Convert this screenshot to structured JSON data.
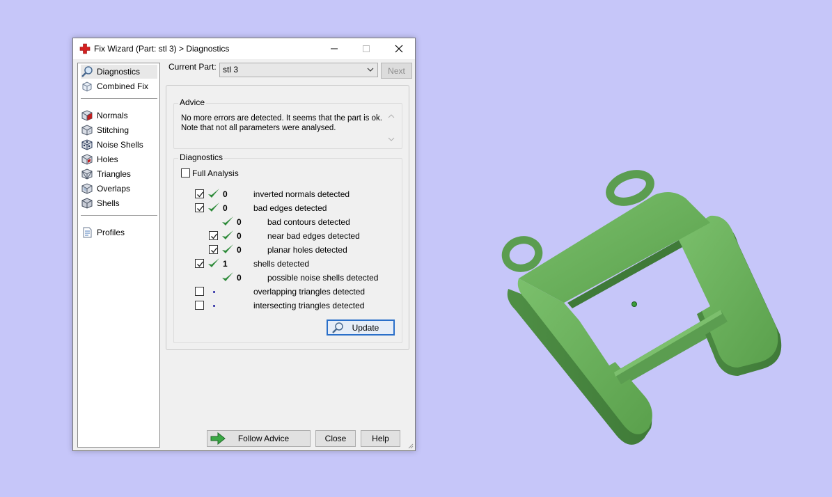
{
  "window": {
    "title": "Fix Wizard (Part: stl 3) > Diagnostics"
  },
  "nav": {
    "items": [
      {
        "label": "Diagnostics",
        "icon": "magnifier-icon",
        "selected": true
      },
      {
        "label": "Combined Fix",
        "icon": "combined-fix-icon"
      },
      {
        "label": "Normals",
        "icon": "normals-cube-icon"
      },
      {
        "label": "Stitching",
        "icon": "stitching-cube-icon"
      },
      {
        "label": "Noise Shells",
        "icon": "noise-shells-cube-icon"
      },
      {
        "label": "Holes",
        "icon": "holes-cube-icon"
      },
      {
        "label": "Triangles",
        "icon": "triangles-cube-icon"
      },
      {
        "label": "Overlaps",
        "icon": "overlaps-cube-icon"
      },
      {
        "label": "Shells",
        "icon": "shells-cube-icon"
      },
      {
        "label": "Profiles",
        "icon": "profiles-document-icon"
      }
    ]
  },
  "part": {
    "label": "Current Part:",
    "value": "stl 3",
    "next_label": "Next"
  },
  "advice": {
    "title": "Advice",
    "text": "No more errors are detected. It seems that the part is ok.\nNote that not all parameters were analysed."
  },
  "diagnostics": {
    "title": "Diagnostics",
    "full_analysis_label": "Full Analysis",
    "full_analysis_checked": false,
    "rows": [
      {
        "checkbox": true,
        "checked": true,
        "status": "ok",
        "count": "0",
        "label": "inverted normals detected",
        "indent": 0
      },
      {
        "checkbox": true,
        "checked": true,
        "status": "ok",
        "count": "0",
        "label": "bad edges detected",
        "indent": 0
      },
      {
        "checkbox": false,
        "checked": false,
        "status": "ok",
        "count": "0",
        "label": "bad contours detected",
        "indent": 1
      },
      {
        "checkbox": true,
        "checked": true,
        "status": "ok",
        "count": "0",
        "label": "near bad edges detected",
        "indent": 1
      },
      {
        "checkbox": true,
        "checked": true,
        "status": "ok",
        "count": "0",
        "label": "planar holes detected",
        "indent": 1
      },
      {
        "checkbox": true,
        "checked": true,
        "status": "ok",
        "count": "1",
        "label": "shells detected",
        "indent": 0
      },
      {
        "checkbox": false,
        "checked": false,
        "status": "ok",
        "count": "0",
        "label": "possible noise shells detected",
        "indent": 1
      },
      {
        "checkbox": true,
        "checked": false,
        "status": "pending",
        "count": "",
        "label": "overlapping triangles detected",
        "indent": 0
      },
      {
        "checkbox": true,
        "checked": false,
        "status": "pending",
        "count": "",
        "label": "intersecting triangles detected",
        "indent": 0
      }
    ],
    "update_label": "Update"
  },
  "footer": {
    "follow_label": "Follow Advice",
    "close_label": "Close",
    "help_label": "Help"
  },
  "colors": {
    "background": "#c6c6f9",
    "model": "#5c9e50",
    "check": "#2e8b3a",
    "accent": "#2a6fc9"
  }
}
